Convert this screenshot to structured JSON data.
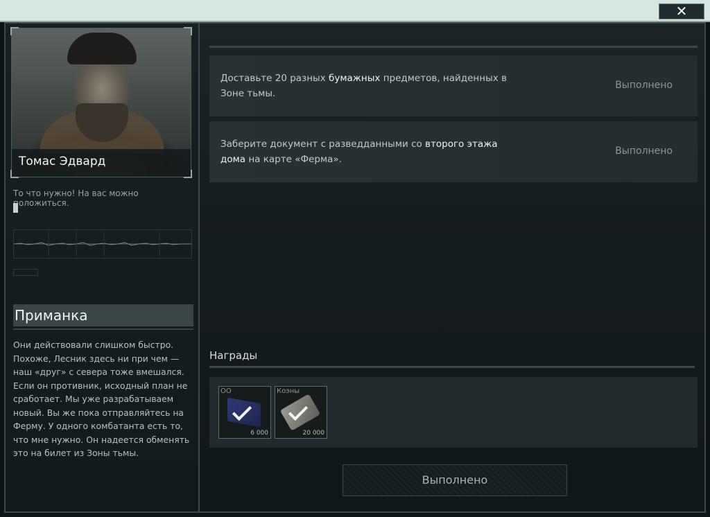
{
  "window": {
    "close_label": "✕"
  },
  "trader": {
    "name": "Томас Эдвард",
    "quote": "То что нужно! На вас можно положиться."
  },
  "quest": {
    "title": "Приманка",
    "description": "Они действовали слишком быстро. Похоже, Лесник здесь ни при чем — наш «друг» с севера тоже вмешался. Если он противник, исходный план не сработает. Мы уже разрабатываем новый. Вы же пока отправляйтесь на Ферму. У одного комбатанта есть то, что мне нужно. Он надеется обменять это на билет из Зоны тьмы."
  },
  "objectives": [
    {
      "text_parts": [
        "Доставьте 20 разных ",
        "бумажных",
        " предметов, найденных в Зоне тьмы."
      ],
      "status": "Выполнено"
    },
    {
      "text_parts": [
        "Заберите документ с разведданными со ",
        "второго этажа дома",
        " на карте «Ферма»."
      ],
      "status": "Выполнено"
    }
  ],
  "rewards": {
    "title": "Награды",
    "items": [
      {
        "label": "ОО",
        "amount": "6 000",
        "icon": "exp-icon"
      },
      {
        "label": "Коэны",
        "amount": "20 000",
        "icon": "coins-icon"
      }
    ]
  },
  "complete_button": "Выполнено",
  "colors": {
    "accent": "#d6e6e2",
    "panel": "#212a2c",
    "text": "#c9d0d2"
  }
}
